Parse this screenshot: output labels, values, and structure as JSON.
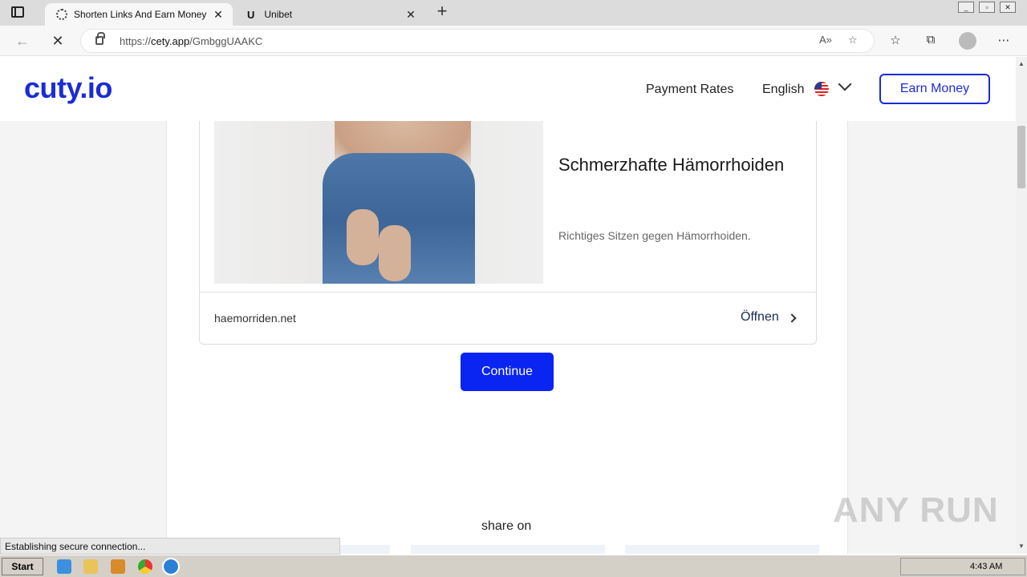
{
  "browser": {
    "tabs": [
      {
        "title": "Shorten Links And Earn Money",
        "active": true
      },
      {
        "title": "Unibet",
        "active": false
      }
    ],
    "url_prefix": "https://",
    "url_host": "cety.app",
    "url_path": "/GmbggUAAKC"
  },
  "site": {
    "logo": "cuty.io",
    "nav": {
      "payment_rates": "Payment Rates",
      "language": "English",
      "earn_money": "Earn Money"
    }
  },
  "ad": {
    "title": "Schmerzhafte Hämorrhoiden",
    "description": "Richtiges Sitzen gegen Hämorrhoiden.",
    "domain": "haemorriden.net",
    "open_label": "Öffnen"
  },
  "main": {
    "continue_label": "Continue",
    "share_label": "share on"
  },
  "status_bar": "Establishing secure connection...",
  "watermark": "ANY RUN",
  "taskbar": {
    "start_label": "Start",
    "clock": "4:43 AM"
  },
  "colors": {
    "brand": "#1b2bd6",
    "continue": "#0a24f2"
  }
}
